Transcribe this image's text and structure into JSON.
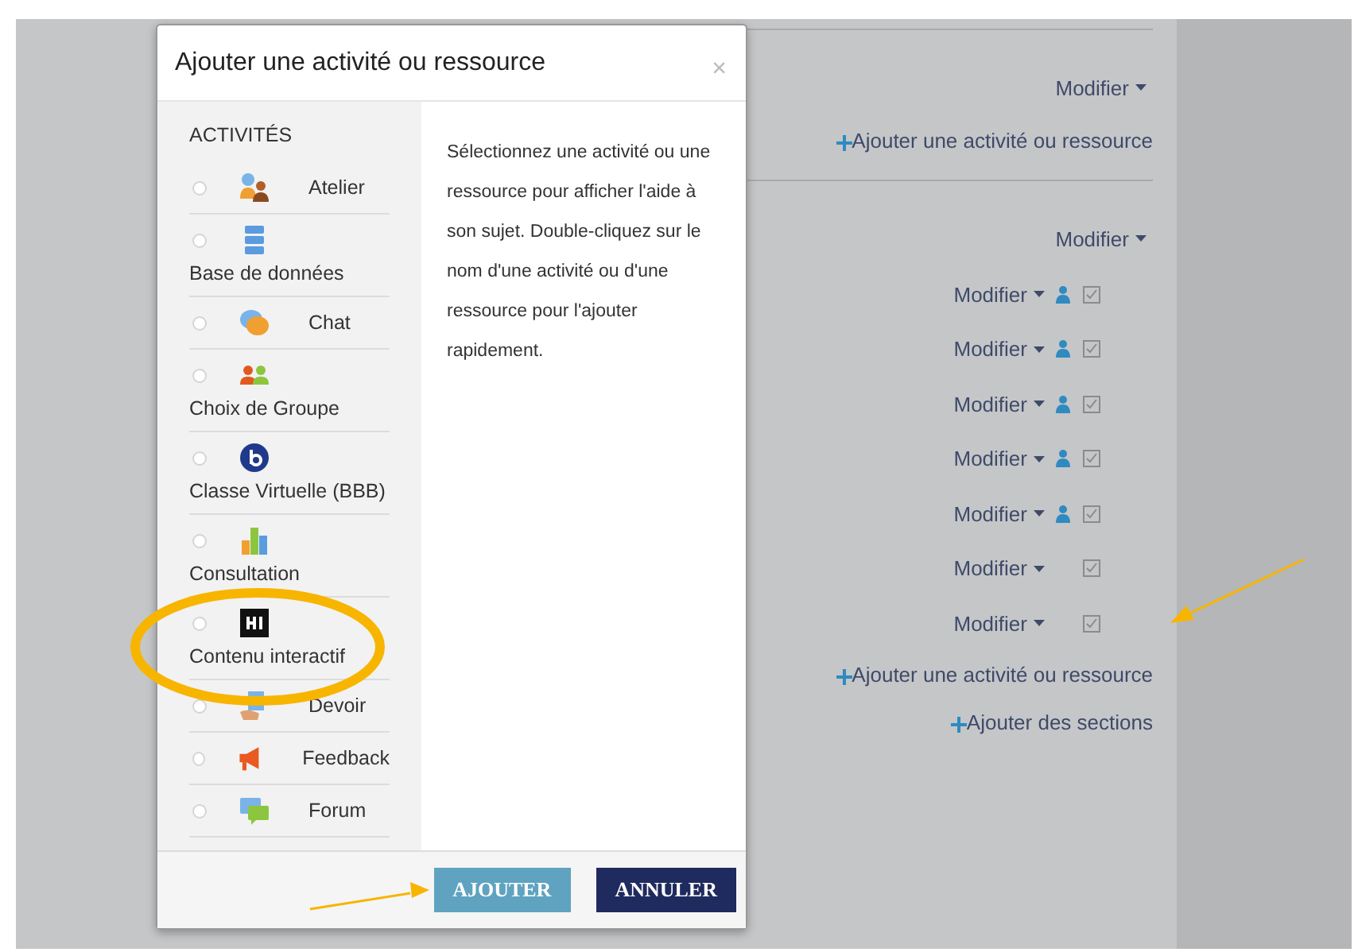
{
  "course": {
    "sections": [
      {
        "menu": "Modifier",
        "add_link": "Ajouter une activité ou ressource"
      },
      {
        "menu": "Modifier",
        "activities": [
          {
            "menu": "Modifier",
            "restricted": true
          },
          {
            "menu": "Modifier",
            "restricted": true
          },
          {
            "menu": "Modifier",
            "restricted": true
          },
          {
            "menu": "Modifier",
            "restricted": true
          },
          {
            "menu": "Modifier",
            "restricted": true
          },
          {
            "menu": "Modifier",
            "restricted": false
          },
          {
            "menu": "Modifier",
            "restricted": false
          }
        ],
        "add_link": "Ajouter une activité ou ressource"
      }
    ],
    "add_sections": "Ajouter des sections"
  },
  "dialog": {
    "title": "Ajouter une activité ou ressource",
    "close": "×",
    "section_heading": "ACTIVITÉS",
    "items": [
      {
        "label": "Atelier",
        "kind": "inline",
        "selected": false
      },
      {
        "label": "Base de données",
        "kind": "stacked",
        "selected": false
      },
      {
        "label": "Chat",
        "kind": "inline",
        "selected": false
      },
      {
        "label": "Choix de Groupe",
        "kind": "stacked",
        "selected": false
      },
      {
        "label": "Classe Virtuelle (BBB)",
        "kind": "stacked",
        "selected": false
      },
      {
        "label": "Consultation",
        "kind": "stacked",
        "selected": false
      },
      {
        "label": "Contenu interactif",
        "kind": "stacked",
        "selected": false
      },
      {
        "label": "Devoir",
        "kind": "inline",
        "selected": false
      },
      {
        "label": "Feedback",
        "kind": "inline",
        "selected": false
      },
      {
        "label": "Forum",
        "kind": "inline",
        "selected": false
      }
    ],
    "help": "Sélectionnez une activité ou une ressource pour afficher l'aide à son sujet. Double-cliquez sur le nom d'une activité ou d'une ressource pour l'ajouter rapidement.",
    "buttons": [
      {
        "label": "AJOUTER",
        "kind": "primary"
      },
      {
        "label": "ANNULER",
        "kind": "secondary"
      }
    ]
  }
}
